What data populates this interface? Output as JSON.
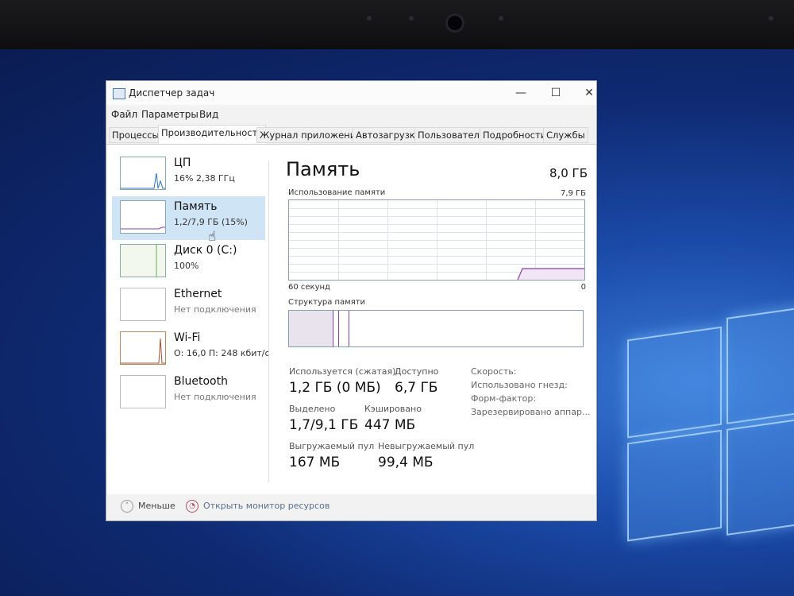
{
  "window": {
    "title": "Диспетчер задач",
    "controls": {
      "minimize": "—",
      "maximize": "☐",
      "close": "✕"
    }
  },
  "menu": [
    "Файл",
    "Параметры",
    "Вид"
  ],
  "tabs": [
    {
      "label": "Процессы",
      "active": false
    },
    {
      "label": "Производительность",
      "active": true
    },
    {
      "label": "Журнал приложений",
      "active": false
    },
    {
      "label": "Автозагрузка",
      "active": false
    },
    {
      "label": "Пользователи",
      "active": false
    },
    {
      "label": "Подробности",
      "active": false
    },
    {
      "label": "Службы",
      "active": false
    }
  ],
  "sidebar": {
    "items": [
      {
        "name": "ЦП",
        "sub": "16%  2,38 ГГц",
        "selected": false
      },
      {
        "name": "Память",
        "sub": "1,2/7,9 ГБ (15%)",
        "selected": true
      },
      {
        "name": "Диск 0 (C:)",
        "sub": "100%",
        "selected": false
      },
      {
        "name": "Ethernet",
        "sub": "Нет подключения",
        "selected": false
      },
      {
        "name": "Wi-Fi",
        "sub": "О: 16,0  П: 248 кбит/с",
        "selected": false
      },
      {
        "name": "Bluetooth",
        "sub": "Нет подключения",
        "selected": false
      }
    ]
  },
  "memory": {
    "title": "Память",
    "total": "8,0 ГБ",
    "usage_label": "Использование памяти",
    "usage_max": "7,9 ГБ",
    "time_label": "60 секунд",
    "zero_label": "0",
    "structure_label": "Структура памяти",
    "stats": {
      "in_use_label": "Используется (сжатая)",
      "in_use_value": "1,2 ГБ (0 МБ)",
      "available_label": "Доступно",
      "available_value": "6,7 ГБ",
      "committed_label": "Выделено",
      "committed_value": "1,7/9,1 ГБ",
      "cached_label": "Кэшировано",
      "cached_value": "447 МБ",
      "paged_label": "Выгружаемый пул",
      "paged_value": "167 МБ",
      "nonpaged_label": "Невыгружаемый пул",
      "nonpaged_value": "99,4 МБ"
    },
    "info": {
      "speed": "Скорость:",
      "slots": "Использовано гнезд:",
      "form_factor": "Форм-фактор:",
      "reserved": "Зарезервировано аппар..."
    }
  },
  "footer": {
    "less": "Меньше",
    "resource_monitor": "Открыть монитор ресурсов"
  },
  "colors": {
    "memory_accent": "#8b3fa8",
    "selection": "#cfe4f5"
  }
}
